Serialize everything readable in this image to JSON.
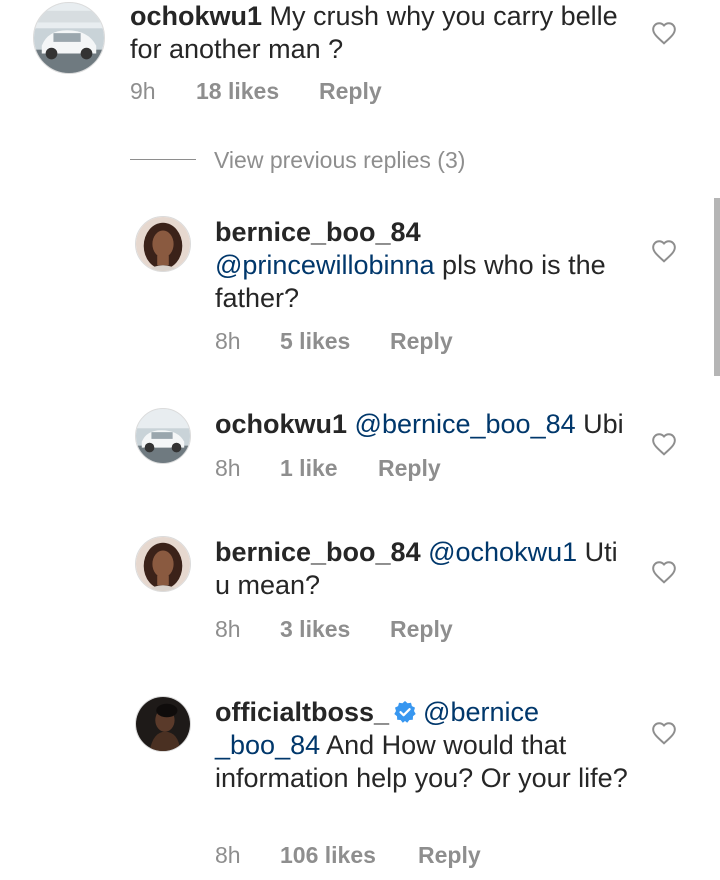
{
  "thread": {
    "view_previous_label": "View previous replies (3)"
  },
  "comments": [
    {
      "username": "ochokwu1",
      "mention": "",
      "text": "My crush why you carry belle for another man ?",
      "time": "9h",
      "likes": "18 likes",
      "reply": "Reply",
      "avatar": "car-photo"
    },
    {
      "username": "bernice_boo_84",
      "mention": "@princewillobinna",
      "text": "pls who is the father?",
      "time": "8h",
      "likes": "5 likes",
      "reply": "Reply",
      "avatar": "woman-photo"
    },
    {
      "username": "ochokwu1",
      "mention": "@bernice_boo_84",
      "text": "Ubi",
      "time": "8h",
      "likes": "1 like",
      "reply": "Reply",
      "avatar": "car-photo"
    },
    {
      "username": "bernice_boo_84",
      "mention": "@ochokwu1",
      "text": "Uti u mean?",
      "time": "8h",
      "likes": "3 likes",
      "reply": "Reply",
      "avatar": "woman-photo"
    },
    {
      "username": "officialtboss_",
      "verified": true,
      "mention": "@bernice _boo_84",
      "text": "And How would that information help you? Or your life?",
      "time": "8h",
      "likes": "106 likes",
      "reply": "Reply",
      "avatar": "dark-portrait-photo"
    }
  ],
  "icons": {
    "like": "heart-outline-icon",
    "verified": "verified-badge-icon"
  },
  "colors": {
    "text": "#262626",
    "secondary": "#8e8e8e",
    "mention": "#00376b",
    "verified": "#3897f0"
  }
}
